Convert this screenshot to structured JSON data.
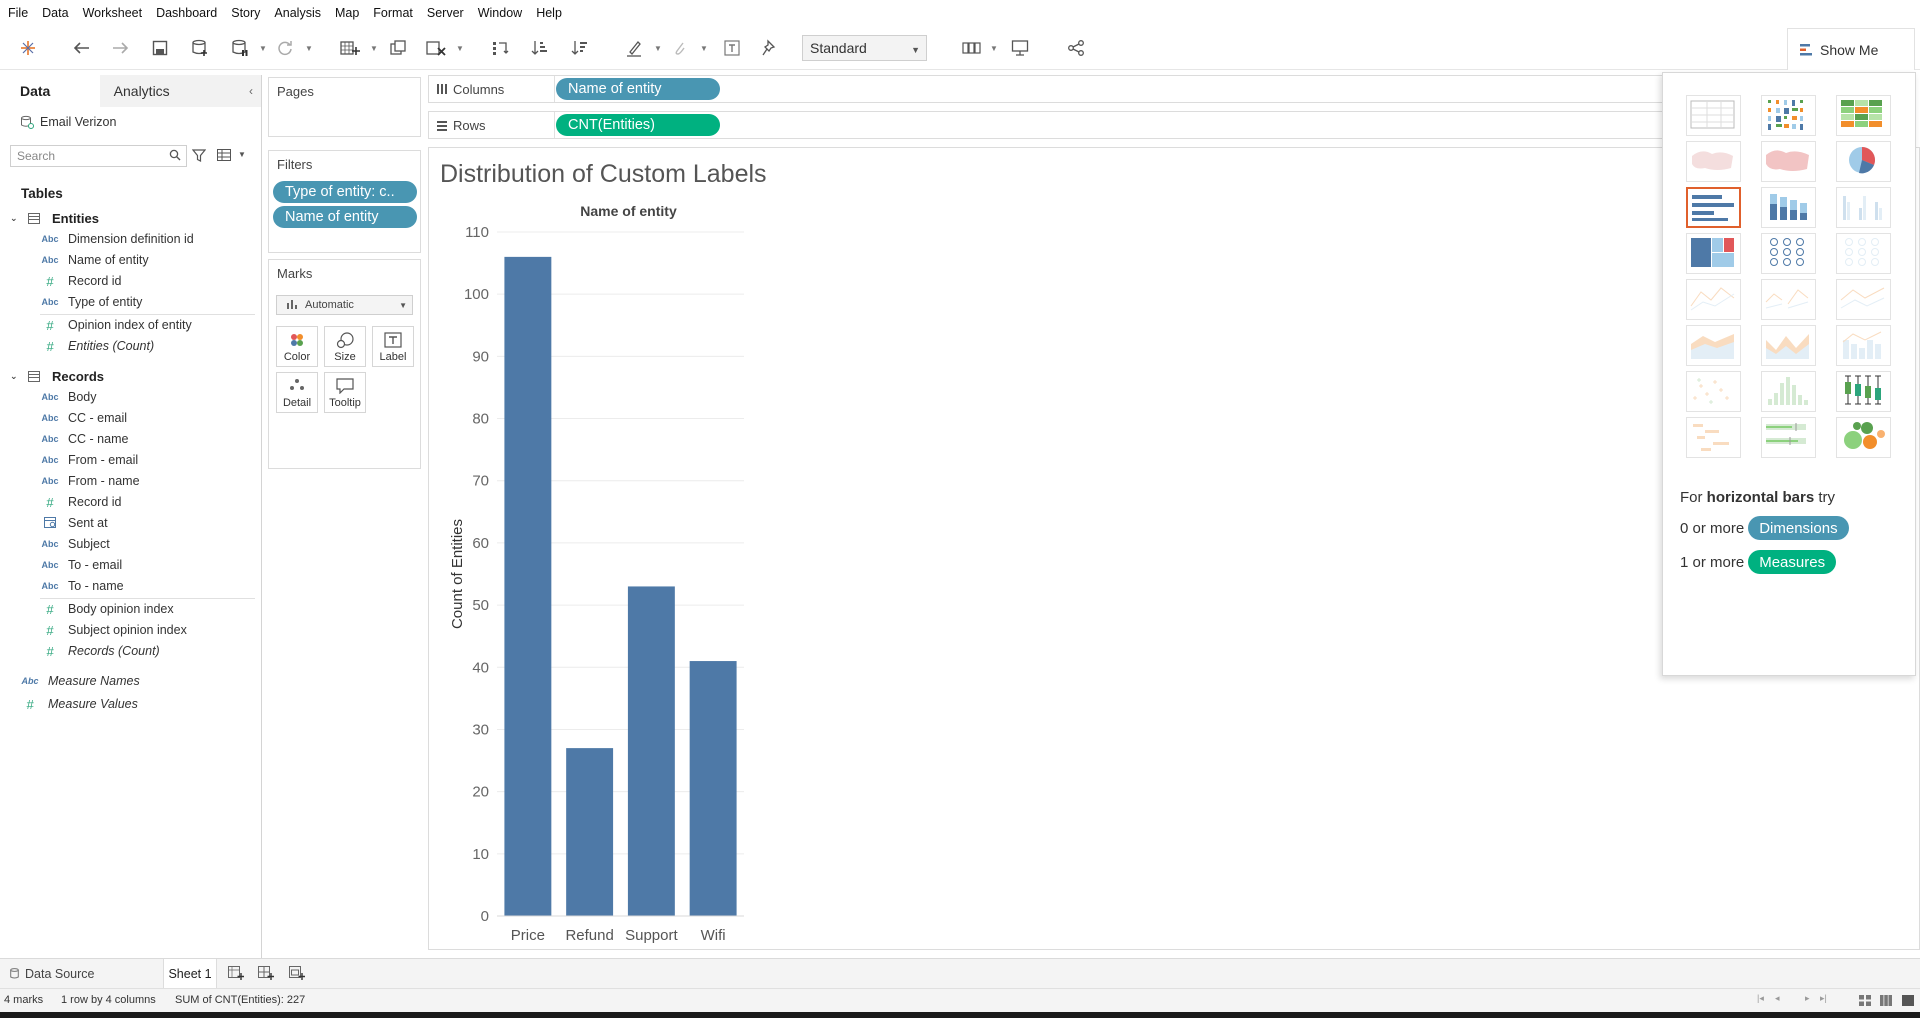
{
  "menu": [
    "File",
    "Data",
    "Worksheet",
    "Dashboard",
    "Story",
    "Analysis",
    "Map",
    "Format",
    "Server",
    "Window",
    "Help"
  ],
  "toolbar": {
    "fit": "Standard",
    "show_me": "Show Me"
  },
  "data_pane": {
    "tab_data": "Data",
    "tab_analytics": "Analytics",
    "datasource": "Email Verizon",
    "search_placeholder": "Search",
    "tables_heading": "Tables",
    "entities": {
      "name": "Entities",
      "fields": [
        {
          "type": "Abc",
          "label": "Dimension definition id"
        },
        {
          "type": "Abc",
          "label": "Name of entity"
        },
        {
          "type": "#",
          "label": "Record id"
        },
        {
          "type": "Abc",
          "label": "Type of entity"
        },
        {
          "type": "#",
          "label": "Opinion index of entity"
        },
        {
          "type": "#",
          "label": "Entities (Count)"
        }
      ]
    },
    "records": {
      "name": "Records",
      "fields": [
        {
          "type": "Abc",
          "label": "Body"
        },
        {
          "type": "Abc",
          "label": "CC - email"
        },
        {
          "type": "Abc",
          "label": "CC - name"
        },
        {
          "type": "Abc",
          "label": "From - email"
        },
        {
          "type": "Abc",
          "label": "From - name"
        },
        {
          "type": "#",
          "label": "Record id"
        },
        {
          "type": "date",
          "label": "Sent at"
        },
        {
          "type": "Abc",
          "label": "Subject"
        },
        {
          "type": "Abc",
          "label": "To - email"
        },
        {
          "type": "Abc",
          "label": "To - name"
        },
        {
          "type": "#",
          "label": "Body opinion index"
        },
        {
          "type": "#",
          "label": "Subject opinion index"
        },
        {
          "type": "#",
          "label": "Records (Count)"
        }
      ]
    },
    "measure_names": "Measure Names",
    "measure_values": "Measure Values"
  },
  "cards": {
    "pages": "Pages",
    "filters": "Filters",
    "filter_pills": [
      "Type of entity: c..",
      "Name of entity"
    ],
    "marks": "Marks",
    "marks_type": "Automatic",
    "mark_buttons": [
      "Color",
      "Size",
      "Label",
      "Detail",
      "Tooltip"
    ]
  },
  "shelves": {
    "columns_label": "Columns",
    "columns_pill": "Name of entity",
    "rows_label": "Rows",
    "rows_pill": "CNT(Entities)"
  },
  "viz": {
    "title": "Distribution of Custom Labels"
  },
  "chart_data": {
    "type": "bar",
    "title": "Distribution of Custom Labels",
    "header": "Name of entity",
    "categories": [
      "Price",
      "Refund",
      "Support",
      "Wifi"
    ],
    "values": [
      106,
      27,
      53,
      41
    ],
    "ylabel": "Count of Entities",
    "ylim": [
      0,
      110
    ],
    "yticks": [
      0,
      10,
      20,
      30,
      40,
      50,
      60,
      70,
      80,
      90,
      100,
      110
    ],
    "color": "#4e79a7",
    "grid": true
  },
  "show_me": {
    "hint_prefix": "For",
    "hint_bold": "horizontal bars",
    "hint_suffix": "try",
    "dim_prefix": "0 or more",
    "dim_pill": "Dimensions",
    "mea_prefix": "1 or more",
    "mea_pill": "Measures"
  },
  "tabs": {
    "data_source": "Data Source",
    "sheet": "Sheet 1"
  },
  "status": {
    "marks": "4 marks",
    "rows_cols": "1 row by 4 columns",
    "sum": "SUM of CNT(Entities): 227"
  }
}
